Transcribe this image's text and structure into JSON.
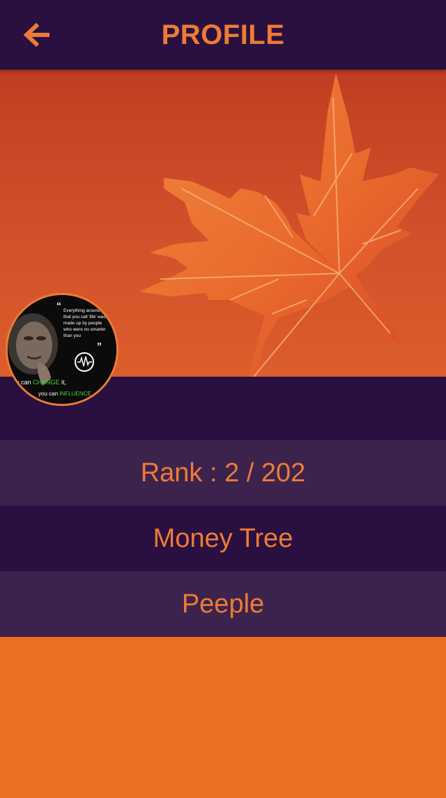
{
  "header": {
    "title": "PROFILE",
    "back_icon": "arrow-left-icon"
  },
  "colors": {
    "header_bg": "#2a1040",
    "accent": "#ee7b35",
    "row_light": "#3c234d",
    "row_dark": "#2a1040",
    "page_bg": "#ea6f23"
  },
  "avatar": {
    "quote_text": [
      "Everything around you",
      "that you call 'life' was",
      "made up by people",
      "who were no smarter",
      "than you"
    ],
    "bottom_text_1_prefix": "you can ",
    "bottom_text_1_highlight": "CHANGE",
    "bottom_text_1_suffix": " it,",
    "bottom_text_2_prefix": "you can ",
    "bottom_text_2_highlight": "INFLUENCE"
  },
  "profile": {
    "rank_text": "Rank : 2 / 202",
    "name": "Money Tree",
    "subtitle": "Peeple"
  }
}
